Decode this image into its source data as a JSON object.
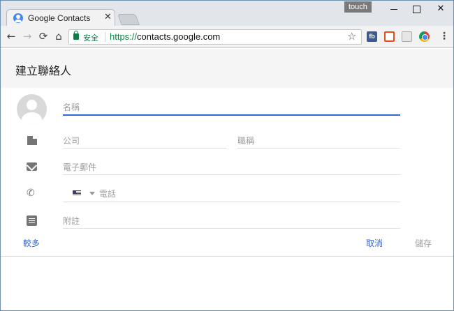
{
  "browser": {
    "tab": {
      "title": "Google Contacts",
      "close_glyph": "✕"
    },
    "touch_badge": "touch",
    "window_controls": {
      "close_glyph": "✕"
    },
    "nav": {
      "back": "←",
      "forward": "→",
      "reload": "⟳",
      "home": "⌂"
    },
    "address": {
      "secure_label": "安全",
      "scheme": "https://",
      "host": "contacts.google.com"
    },
    "star_glyph": "☆",
    "extensions": {
      "fb_label": "fb"
    },
    "menu_glyph": "⋮"
  },
  "dialog": {
    "title": "建立聯絡人",
    "fields": {
      "name_placeholder": "名稱",
      "company_placeholder": "公司",
      "job_title_placeholder": "職稱",
      "email_placeholder": "電子郵件",
      "phone_placeholder": "電話",
      "notes_placeholder": "附註"
    },
    "phone_glyph": "✆",
    "buttons": {
      "more": "較多",
      "cancel": "取消",
      "save": "儲存"
    },
    "colors": {
      "accent": "#3367d6",
      "disabled": "#a0a0a0",
      "secure_green": "#0b8043"
    }
  }
}
